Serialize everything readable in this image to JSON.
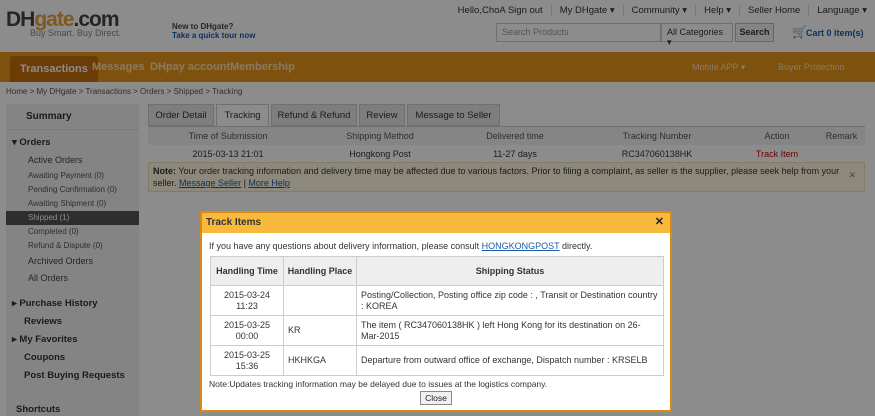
{
  "header": {
    "logo_dh": "DH",
    "logo_gate": "gate",
    "logo_com": ".com",
    "slogan_a": "Buy Smart. Buy Direct.",
    "newto_1": "New to DHgate?",
    "newto_2": "Take a quick tour now",
    "top_links": [
      "Hello,ChoA Sign out",
      "My DHgate ▾",
      "Community ▾",
      "Help ▾",
      "Seller Home",
      "Language ▾"
    ],
    "search_placeholder": "Search Products",
    "category": "All Categories ▾",
    "search_btn": "Search",
    "cart": "Cart 0 item(s)"
  },
  "nav": {
    "tabs": [
      "Transactions",
      "Messages",
      "DHpay account",
      "Membership"
    ],
    "mobile": "Mobile APP ▾",
    "buyer": "Buyer Protection"
  },
  "breadcrumb": "Home > My DHgate > Transactions > Orders > Shipped > Tracking",
  "sidebar": {
    "summary": "Summary",
    "orders": "Orders",
    "active_orders": "Active Orders",
    "subs": [
      "Awaiting Payment (0)",
      "Pending Confirmation (0)",
      "Awaiting Shipment (0)",
      "Shipped (1)",
      "Completed (0)",
      "Refund & Dispute (0)"
    ],
    "archived": "Archived Orders",
    "all": "All Orders",
    "purchase": "Purchase History",
    "reviews": "Reviews",
    "favorites": "My Favorites",
    "coupons": "Coupons",
    "post": "Post Buying Requests",
    "shortcuts": "Shortcuts"
  },
  "tabs": [
    "Order Detail",
    "Tracking",
    "Refund & Refund",
    "Review",
    "Message to Seller"
  ],
  "table": {
    "headers": [
      "Time of Submission",
      "Shipping Method",
      "Delivered time",
      "Tracking Number",
      "Action",
      "Remark"
    ],
    "row": [
      "2015-03-13 21:01",
      "Hongkong Post",
      "11-27 days",
      "RC347060138HK",
      "Track Item",
      ""
    ]
  },
  "note": {
    "label": "Note:",
    "text": " Your order tracking information and delivery time may be affected due to various factors. Prior to filing a complaint, as seller is the supplier, please seek help from your seller.",
    "link1": "Message Seller",
    "sep": " | ",
    "link2": "More Help"
  },
  "modal": {
    "title": "Track Items",
    "intro_a": "If you have any questions about delivery information, please consult ",
    "intro_link": "HONGKONGPOST",
    "intro_b": " directly.",
    "headers": [
      "Handling Time",
      "Handling Place",
      "Shipping Status"
    ],
    "rows": [
      {
        "time": "2015-03-24 11:23",
        "place": "",
        "status": "Posting/Collection, Posting office zip code : , Transit or Destination country : KOREA"
      },
      {
        "time": "2015-03-25 00:00",
        "place": "KR",
        "status": "The item ( RC347060138HK ) left Hong Kong for its destination on 26-Mar-2015"
      },
      {
        "time": "2015-03-25 15:36",
        "place": "HKHKGA",
        "status": "Departure from outward office of exchange, Dispatch number : KRSELB"
      }
    ],
    "note": "Note:Updates tracking information may be delayed due to issues at the logistics company.",
    "close": "Close"
  }
}
